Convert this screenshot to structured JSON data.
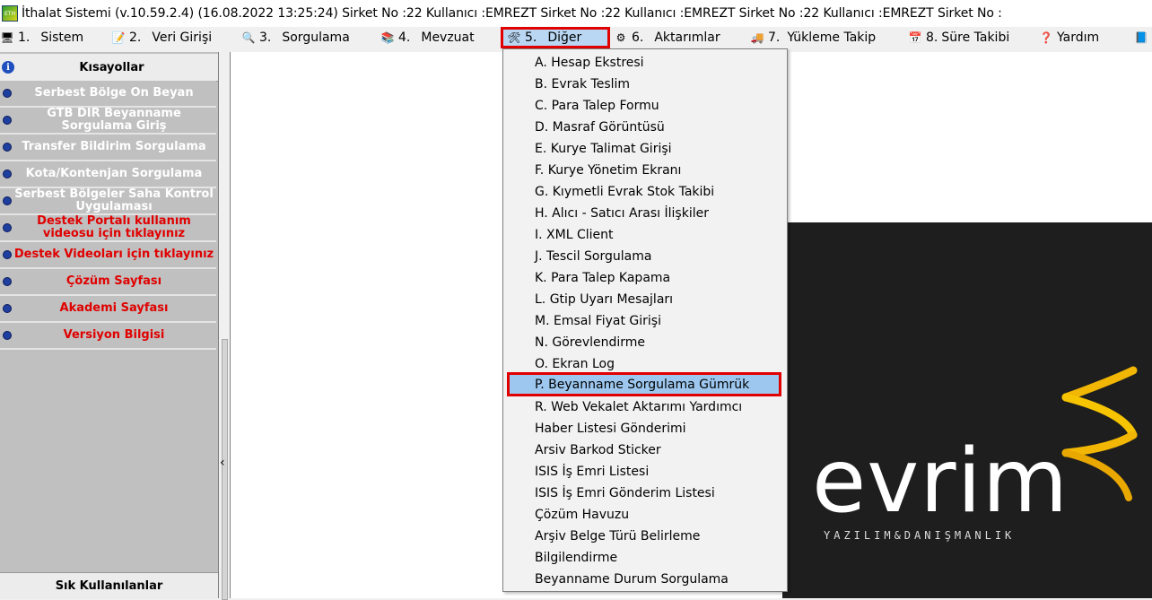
{
  "window": {
    "title": "İthalat Sistemi (v.10.59.2.4) (16.08.2022 13:25:24) Sirket No :22 Kullanıcı :EMREZT Sirket No :22 Kullanıcı :EMREZT Sirket No :22 Kullanıcı :EMREZT Sirket No :",
    "icon": "app-icon"
  },
  "menu": [
    {
      "num": "1.",
      "label": "Sistem",
      "icon": "computer-icon"
    },
    {
      "num": "2.",
      "label": "Veri Girişi",
      "icon": "notepad-icon"
    },
    {
      "num": "3.",
      "label": "Sorgulama",
      "icon": "magnifier-icon"
    },
    {
      "num": "4.",
      "label": "Mevzuat",
      "icon": "books-icon"
    },
    {
      "num": "5.",
      "label": "Diğer",
      "icon": "tools-icon"
    },
    {
      "num": "6.",
      "label": "Aktarımlar",
      "icon": "transfer-icon"
    },
    {
      "num": "7.",
      "label": "Yükleme Takip",
      "icon": "truck-icon"
    },
    {
      "num": "8.",
      "label": "Süre Takibi",
      "icon": "calendar-icon"
    },
    {
      "num": "",
      "label": "Yardım",
      "icon": "help-icon"
    }
  ],
  "sidebar": {
    "header": "Kısayollar",
    "items": [
      {
        "label": "Serbest Bölge Ön Beyan",
        "color": "white"
      },
      {
        "label": "GTB DIR Beyanname Sorgulama Giriş",
        "color": "white"
      },
      {
        "label": "Transfer Bildirim Sorgulama",
        "color": "white"
      },
      {
        "label": "Kota/Kontenjan Sorgulama",
        "color": "white"
      },
      {
        "label": "Serbest Bölgeler Saha Kontrol Uygulaması",
        "color": "white"
      },
      {
        "label": "Destek Portalı kullanım videosu için tıklayınız",
        "color": "red"
      },
      {
        "label": "Destek Videoları için tıklayınız",
        "color": "red"
      },
      {
        "label": "Çözüm Sayfası",
        "color": "red"
      },
      {
        "label": "Akademi Sayfası",
        "color": "red"
      },
      {
        "label": "Versiyon Bilgisi",
        "color": "red"
      }
    ],
    "footer": "Sık Kullanılanlar"
  },
  "dropdown": {
    "items": [
      "A. Hesap Ekstresi",
      "B. Evrak Teslim",
      "C. Para Talep Formu",
      "D. Masraf Görüntüsü",
      "E. Kurye Talimat Girişi",
      "F. Kurye Yönetim Ekranı",
      "G. Kıymetli Evrak Stok Takibi",
      "H. Alıcı - Satıcı Arası İlişkiler",
      "I. XML Client",
      "J. Tescil Sorgulama",
      "K. Para Talep Kapama",
      "L. Gtip Uyarı Mesajları",
      "M. Emsal Fiyat Girişi",
      "N. Görevlendirme",
      "O. Ekran Log",
      "P. Beyanname Sorgulama Gümrük",
      "R. Web Vekalet Aktarımı Yardımcı",
      "Haber Listesi Gönderimi",
      "Arsiv Barkod Sticker",
      "ISIS İş Emri Listesi",
      "ISIS İş Emri Gönderim Listesi",
      "Çözüm Havuzu",
      "Arşiv Belge Türü Belirleme",
      "Bilgilendirme",
      "Beyanname Durum Sorgulama"
    ],
    "highlighted_index": 15
  },
  "logo": {
    "wordmark": "evrim",
    "tagline": "YAZILIM&DANIŞMANLIK"
  },
  "colors": {
    "highlight_border": "#e00000",
    "menu_selected_bg": "#b9d7f3",
    "dropdown_highlight_bg": "#9dc7ee",
    "logo_dark_bg": "#1e1e1e",
    "logo_accent": "#f2b705"
  }
}
